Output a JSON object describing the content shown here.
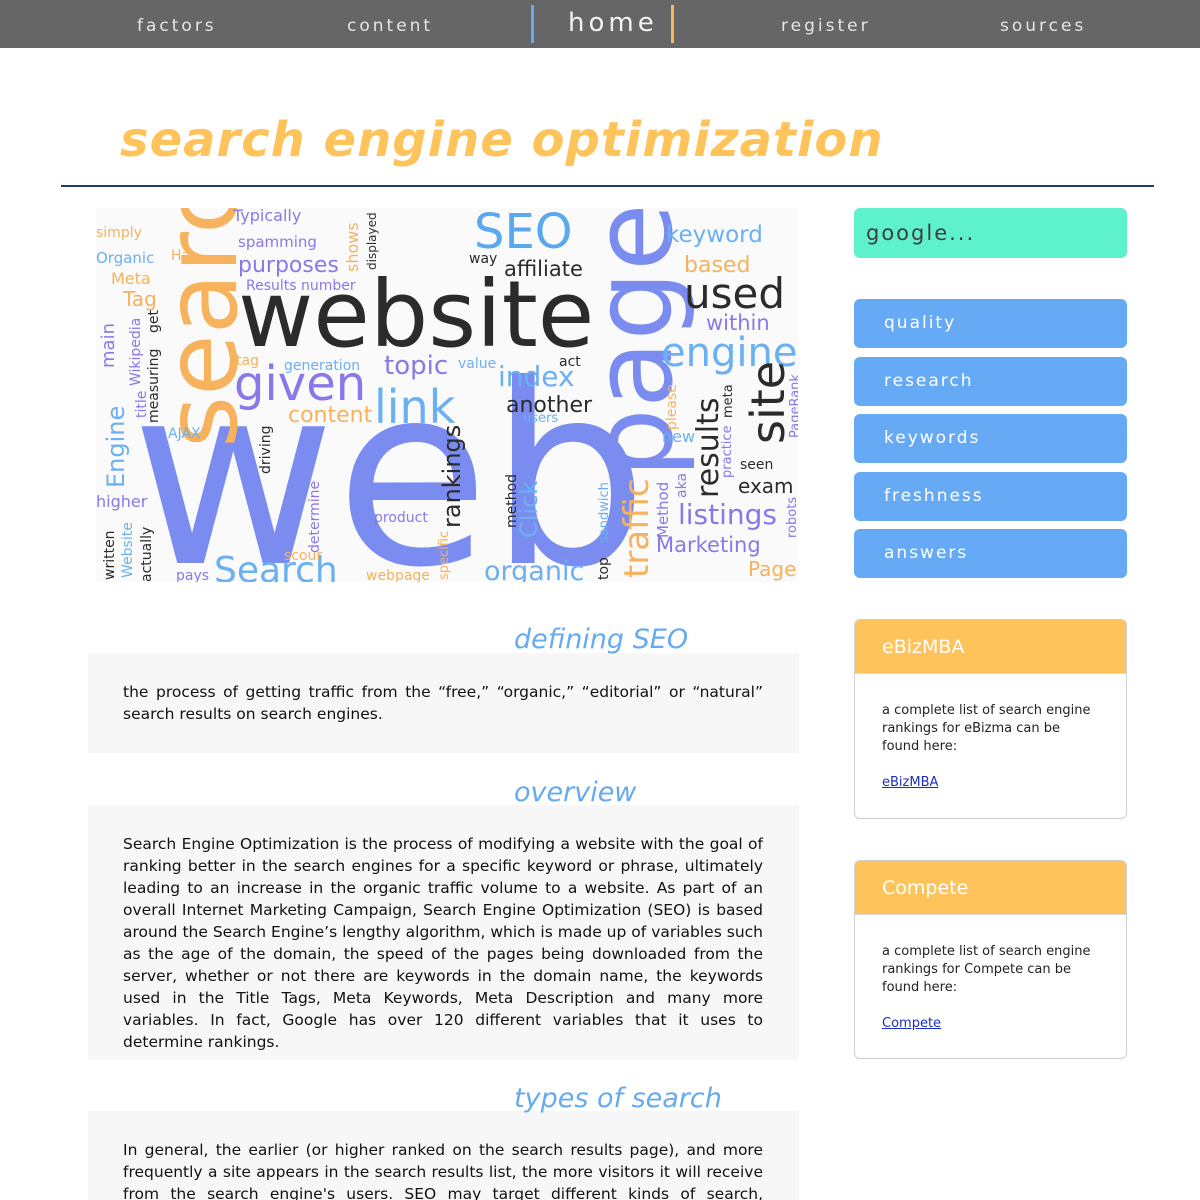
{
  "nav": {
    "items": [
      {
        "label": "factors"
      },
      {
        "label": "content"
      },
      {
        "label": "home"
      },
      {
        "label": "register"
      },
      {
        "label": "sources"
      }
    ]
  },
  "page": {
    "title": "search engine optimization"
  },
  "word_cloud": {
    "words": [
      {
        "text": "web",
        "color": "#7a8cf0"
      },
      {
        "text": "website",
        "color": "#2b2b2b"
      },
      {
        "text": "page",
        "color": "#7a8cf0"
      },
      {
        "text": "search",
        "color": "#f6b25c"
      },
      {
        "text": "SEO",
        "color": "#5aa8ee"
      },
      {
        "text": "given",
        "color": "#8a78e8"
      },
      {
        "text": "link",
        "color": "#6ab0f2"
      },
      {
        "text": "engine",
        "color": "#6ab0f2"
      },
      {
        "text": "used",
        "color": "#2b2b2b"
      },
      {
        "text": "site",
        "color": "#2b2b2b"
      },
      {
        "text": "index",
        "color": "#6ab0f2"
      },
      {
        "text": "topic",
        "color": "#8a78e8"
      },
      {
        "text": "content",
        "color": "#f6b25c"
      },
      {
        "text": "another",
        "color": "#2b2b2b"
      },
      {
        "text": "rankings",
        "color": "#2b2b2b"
      },
      {
        "text": "traffic",
        "color": "#f6b25c"
      },
      {
        "text": "results",
        "color": "#2b2b2b"
      },
      {
        "text": "listings",
        "color": "#8a78e8"
      },
      {
        "text": "Marketing",
        "color": "#8a78e8"
      },
      {
        "text": "organic",
        "color": "#6ab0f2"
      },
      {
        "text": "Search",
        "color": "#6ab0f2"
      },
      {
        "text": "keyword",
        "color": "#6ab0f2"
      },
      {
        "text": "based",
        "color": "#f6b25c"
      },
      {
        "text": "affiliate",
        "color": "#2b2b2b"
      },
      {
        "text": "within",
        "color": "#8a78e8"
      },
      {
        "text": "purposes",
        "color": "#8a78e8"
      },
      {
        "text": "Typically",
        "color": "#8a78e8"
      },
      {
        "text": "spamming",
        "color": "#8a78e8"
      },
      {
        "text": "Results number",
        "color": "#8a78e8"
      },
      {
        "text": "generation",
        "color": "#6ab0f2"
      },
      {
        "text": "value",
        "color": "#6ab0f2"
      },
      {
        "text": "product",
        "color": "#8a78e8"
      },
      {
        "text": "Click",
        "color": "#6ab0f2"
      },
      {
        "text": "method",
        "color": "#2b2b2b"
      },
      {
        "text": "exam",
        "color": "#2b2b2b"
      },
      {
        "text": "seen",
        "color": "#2b2b2b"
      },
      {
        "text": "new",
        "color": "#6ab0f2"
      },
      {
        "text": "users",
        "color": "#6ab0f2"
      },
      {
        "text": "Page",
        "color": "#f6b25c"
      },
      {
        "text": "webpage",
        "color": "#f6b25c"
      },
      {
        "text": "pays",
        "color": "#8a78e8"
      },
      {
        "text": "Tag",
        "color": "#f6b25c"
      },
      {
        "text": "Meta",
        "color": "#f6b25c"
      },
      {
        "text": "Organic",
        "color": "#6ab0f2"
      },
      {
        "text": "simply",
        "color": "#f6b25c"
      },
      {
        "text": "Hat",
        "color": "#f6b25c"
      },
      {
        "text": "tag",
        "color": "#f6b25c"
      },
      {
        "text": "AJAX",
        "color": "#6ab0f2"
      },
      {
        "text": "higher",
        "color": "#8a78e8"
      },
      {
        "text": "Engine",
        "color": "#6ab0f2"
      },
      {
        "text": "main",
        "color": "#8a78e8"
      },
      {
        "text": "title",
        "color": "#8a78e8"
      },
      {
        "text": "Wikipedia",
        "color": "#8a78e8"
      },
      {
        "text": "measuring",
        "color": "#2b2b2b"
      },
      {
        "text": "get",
        "color": "#2b2b2b"
      },
      {
        "text": "driving",
        "color": "#2b2b2b"
      },
      {
        "text": "written",
        "color": "#2b2b2b"
      },
      {
        "text": "Website",
        "color": "#6ab0f2"
      },
      {
        "text": "actually",
        "color": "#2b2b2b"
      },
      {
        "text": "way",
        "color": "#2b2b2b"
      },
      {
        "text": "act",
        "color": "#2b2b2b"
      },
      {
        "text": "shows",
        "color": "#f6b25c"
      },
      {
        "text": "displayed",
        "color": "#2b2b2b"
      },
      {
        "text": "sandwich",
        "color": "#6ab0f2"
      },
      {
        "text": "top",
        "color": "#2b2b2b"
      },
      {
        "text": "Method",
        "color": "#8a78e8"
      },
      {
        "text": "aka",
        "color": "#8a78e8"
      },
      {
        "text": "practice",
        "color": "#8a78e8"
      },
      {
        "text": "meta",
        "color": "#2b2b2b"
      },
      {
        "text": "PageRank",
        "color": "#8a78e8"
      },
      {
        "text": "robots",
        "color": "#8a78e8"
      },
      {
        "text": "please",
        "color": "#f6b25c"
      },
      {
        "text": "determine",
        "color": "#8a78e8"
      },
      {
        "text": "scour",
        "color": "#f6b25c"
      },
      {
        "text": "specific",
        "color": "#f6b25c"
      }
    ]
  },
  "sections": [
    {
      "heading": "defining SEO",
      "text": "the process of getting traffic from the “free,” “organic,” “editorial” or “natural” search results on search engines."
    },
    {
      "heading": "overview",
      "text": "Search Engine Optimization is the process of modifying a website with the goal of ranking better in the search engines for a specific keyword or phrase, ultimately leading to an increase in the organic traffic volume to a website. As part of an overall Internet Marketing Campaign, Search Engine Optimization (SEO) is based around the Search Engine’s lengthy algorithm, which is made up of variables such as the age of the domain, the speed of the pages being downloaded from the server, whether or not there are keywords in the domain name, the keywords used in the Title Tags, Meta Keywords, Meta Description and many more variables. In fact, Google has over 120 different variables that it uses to determine rankings."
    },
    {
      "heading": "types of search",
      "text": "In general, the earlier (or higher ranked on the search results page), and more frequently a site appears in the search results list, the more visitors it will receive from the search engine's users. SEO may target different kinds of search, including:"
    }
  ],
  "sidebar": {
    "search_placeholder": "google...",
    "buttons": [
      {
        "label": "quality"
      },
      {
        "label": "research"
      },
      {
        "label": "keywords"
      },
      {
        "label": "freshness"
      },
      {
        "label": "answers"
      }
    ],
    "cards": [
      {
        "title": "eBizMBA",
        "text": "a complete list of search engine rankings for eBizma can be found here:",
        "link": "eBizMBA"
      },
      {
        "title": "Compete",
        "text": "a complete list of search engine rankings for Compete can be found here:",
        "link": "Compete"
      }
    ]
  },
  "colors": {
    "nav_bg": "#666666",
    "accent_orange": "#ffc35c",
    "accent_blue": "#66aaf5",
    "search_bg": "#5df2cc",
    "rule": "#1f3a78"
  }
}
